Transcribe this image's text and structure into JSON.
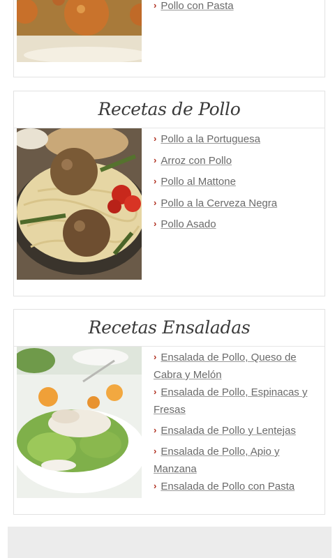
{
  "sections": [
    {
      "title": "",
      "links": [
        "Pollo con Pasta"
      ]
    },
    {
      "title": "Recetas de Pollo",
      "links": [
        "Pollo a la Portuguesa",
        "Arroz con Pollo",
        "Pollo al Mattone",
        "Pollo a la Cerveza Negra",
        "Pollo Asado"
      ]
    },
    {
      "title": "Recetas Ensaladas",
      "links": [
        "Ensalada de Pollo, Queso de Cabra y Melón",
        "Ensalada de Pollo, Espinacas y Fresas",
        "Ensalada de Pollo y Lentejas",
        "Ensalada de Pollo, Apio y Manzana",
        "Ensalada de Pollo con Pasta"
      ]
    }
  ],
  "icons": {
    "bullet": "chevron-right-icon"
  },
  "colors": {
    "accent": "#b03020",
    "border": "#e2e2e2",
    "footer": "#ececec"
  }
}
